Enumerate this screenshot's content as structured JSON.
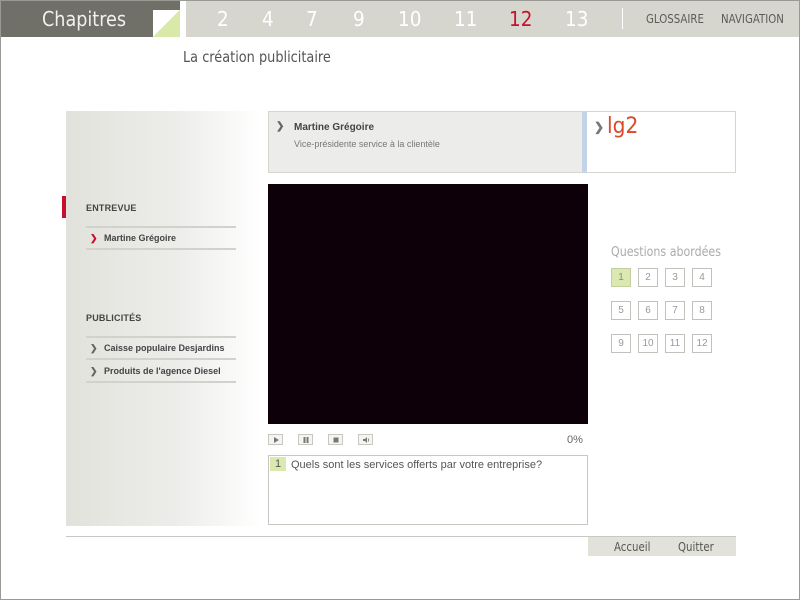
{
  "header": {
    "title": "Chapitres",
    "chapters": [
      {
        "label": "2"
      },
      {
        "label": "4"
      },
      {
        "label": "7"
      },
      {
        "label": "9"
      },
      {
        "label": "10"
      },
      {
        "label": "11"
      },
      {
        "label": "12"
      },
      {
        "label": "13"
      }
    ],
    "active_chapter": "12",
    "glossary": "GLOSSAIRE",
    "navigation": "NAVIGATION"
  },
  "page": {
    "subtitle": "La création publicitaire"
  },
  "sidebar": {
    "interview_heading": "ENTREVUE",
    "interview_items": [
      {
        "label": "Martine Grégoire"
      }
    ],
    "ads_heading": "PUBLICITÉS",
    "ads_items": [
      {
        "label": "Caisse populaire Desjardins"
      },
      {
        "label": "Produits de l'agence Diesel"
      }
    ]
  },
  "speaker": {
    "name": "Martine Grégoire",
    "role": "Vice-présidente service à la clientèle",
    "logo": "lg2"
  },
  "player": {
    "progress_label": "0%",
    "progress": 0
  },
  "question": {
    "number": "1",
    "text": "Quels sont les services offerts par votre entreprise?"
  },
  "questions_panel": {
    "title": "Questions abordées",
    "items": [
      "1",
      "2",
      "3",
      "4",
      "5",
      "6",
      "7",
      "8",
      "9",
      "10",
      "11",
      "12"
    ],
    "active": "1"
  },
  "footer": {
    "home": "Accueil",
    "quit": "Quitter"
  },
  "colors": {
    "accent_red": "#c8102e",
    "highlight_green": "#dbe9b0",
    "header_dark": "#707068",
    "header_light": "#d6d6ce",
    "logo_orange": "#d84a2a"
  },
  "icons": {
    "play": "play-icon",
    "pause": "pause-icon",
    "stop": "stop-icon",
    "volume": "volume-icon",
    "chevron": "chevron-right-icon"
  }
}
